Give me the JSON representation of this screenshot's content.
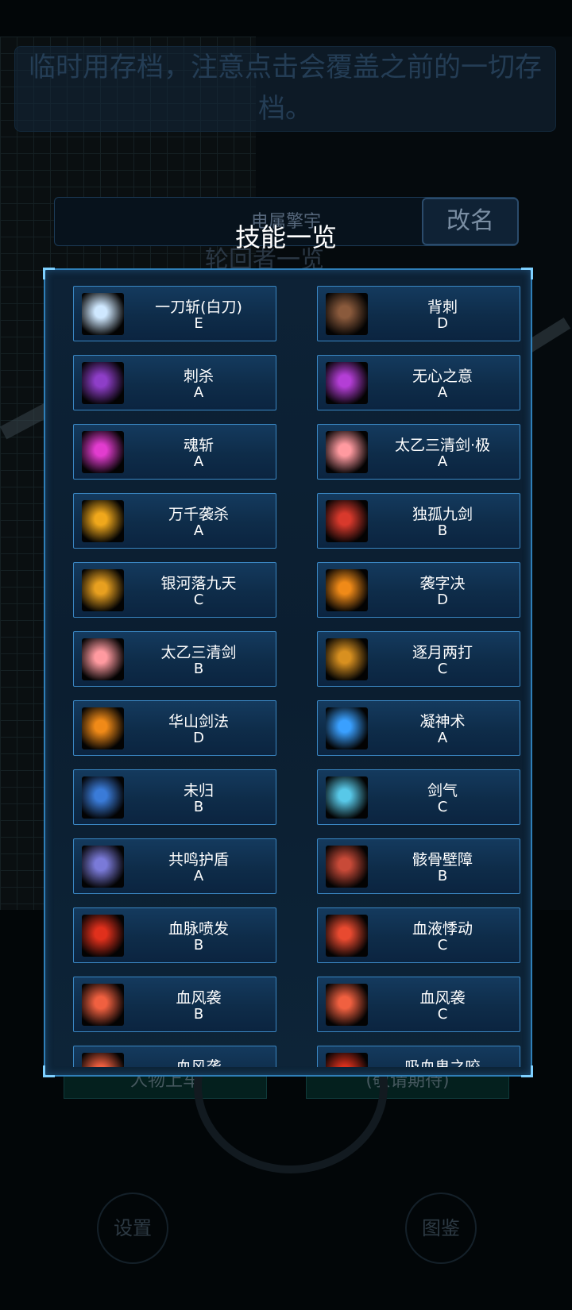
{
  "notice_text": "临时用存档，注意点击会覆盖之前的一切存档。",
  "name_field": "电属擎宇",
  "rename_label": "改名",
  "bg_subtitle": "轮回者一览",
  "bg_buttons": {
    "left": "人物上车",
    "right": "(敬请期待)"
  },
  "bg_settings": "设置",
  "bg_catalog": "图鉴",
  "modal_title": "技能一览",
  "skills": [
    {
      "name": "一刀斩(白刀)",
      "grade": "E",
      "icon": "white-slash-icon",
      "color": "#cfe8ff"
    },
    {
      "name": "背刺",
      "grade": "D",
      "icon": "backstab-icon",
      "color": "#8a5a3c"
    },
    {
      "name": "刺杀",
      "grade": "A",
      "icon": "assassinate-icon",
      "color": "#8e3ec8"
    },
    {
      "name": "无心之意",
      "grade": "A",
      "icon": "heartless-icon",
      "color": "#b43ed6"
    },
    {
      "name": "魂斩",
      "grade": "A",
      "icon": "soul-slash-icon",
      "color": "#e23ccf"
    },
    {
      "name": "太乙三清剑·极",
      "grade": "A",
      "icon": "taiyi-sword-ultimate-icon",
      "color": "#ff9aa0"
    },
    {
      "name": "万千袭杀",
      "grade": "A",
      "icon": "myriad-strike-icon",
      "color": "#f0a81c"
    },
    {
      "name": "独孤九剑",
      "grade": "B",
      "icon": "dugu-sword-icon",
      "color": "#d8392c"
    },
    {
      "name": "银河落九天",
      "grade": "C",
      "icon": "galaxy-fall-icon",
      "color": "#e8a020"
    },
    {
      "name": "袭字决",
      "grade": "D",
      "icon": "raid-art-icon",
      "color": "#f08a18"
    },
    {
      "name": "太乙三清剑",
      "grade": "B",
      "icon": "taiyi-sword-icon",
      "color": "#ff9aa0"
    },
    {
      "name": "逐月两打",
      "grade": "C",
      "icon": "moon-chase-icon",
      "color": "#d89020"
    },
    {
      "name": "华山剑法",
      "grade": "D",
      "icon": "huashan-sword-icon",
      "color": "#f08a18"
    },
    {
      "name": "凝神术",
      "grade": "A",
      "icon": "focus-spell-icon",
      "color": "#3aa0ff"
    },
    {
      "name": "未归",
      "grade": "B",
      "icon": "no-return-icon",
      "color": "#3a7bd8"
    },
    {
      "name": "剑气",
      "grade": "C",
      "icon": "sword-qi-icon",
      "color": "#58c8e8"
    },
    {
      "name": "共鸣护盾",
      "grade": "A",
      "icon": "resonance-shield-icon",
      "color": "#7a7ad8"
    },
    {
      "name": "骸骨壁障",
      "grade": "B",
      "icon": "bone-barrier-icon",
      "color": "#c84a38"
    },
    {
      "name": "血脉喷发",
      "grade": "B",
      "icon": "blood-burst-icon",
      "color": "#e0301c"
    },
    {
      "name": "血液悸动",
      "grade": "C",
      "icon": "blood-pulse-icon",
      "color": "#e84a30"
    },
    {
      "name": "血风袭",
      "grade": "B",
      "icon": "blood-wind-icon",
      "color": "#f06040"
    },
    {
      "name": "血风袭",
      "grade": "C",
      "icon": "blood-wind-icon",
      "color": "#f06040"
    },
    {
      "name": "血风袭",
      "grade": "",
      "icon": "blood-wind-icon",
      "color": "#f06040"
    },
    {
      "name": "吸血鬼之咬",
      "grade": "",
      "icon": "vampire-bite-icon",
      "color": "#d8301c"
    }
  ]
}
